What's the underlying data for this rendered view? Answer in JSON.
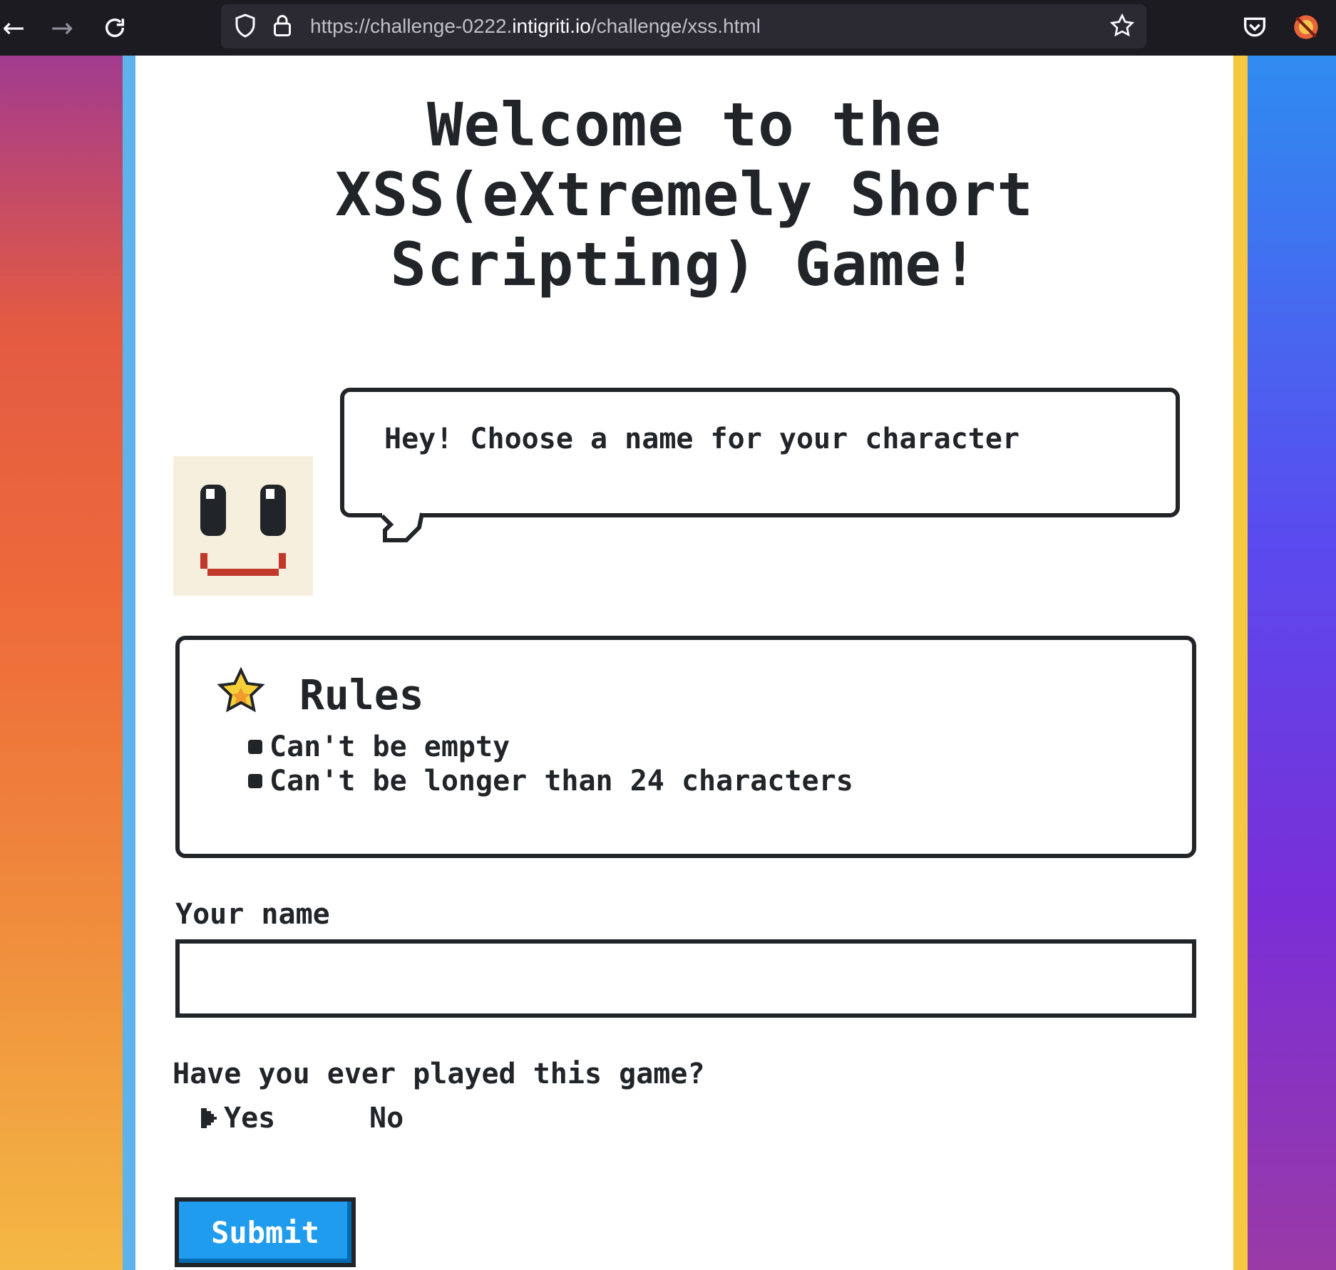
{
  "browser": {
    "url_prefix": "https://challenge-0222.",
    "url_host": "intigriti.io",
    "url_path": "/challenge/xss.html"
  },
  "page": {
    "title_line1": "Welcome to the",
    "title_line2": "XSS(eXtremely Short",
    "title_line3": "Scripting) Game!",
    "bubble_text": "Hey! Choose a name for your character",
    "rules": {
      "title": "Rules",
      "items": [
        "Can't be empty",
        "Can't be longer than 24 characters"
      ]
    },
    "name_label": "Your name",
    "name_value": "",
    "question": "Have you ever played this game?",
    "options": {
      "yes": "Yes",
      "no": "No",
      "selected": "yes"
    },
    "submit_label": "Submit"
  },
  "colors": {
    "ink": "#212529",
    "button": "#209cee",
    "face_bg": "#f6efdd",
    "mouth": "#c0392b"
  }
}
